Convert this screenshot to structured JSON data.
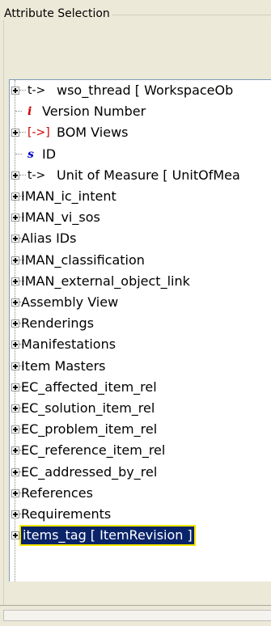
{
  "group_title": "Attribute Selection",
  "tree": [
    {
      "label": "wso_thread [ WorkspaceOb",
      "icon_text": "t->",
      "icon_color": "#000000",
      "expander": true
    },
    {
      "label": "Version Number",
      "icon_text": "i",
      "icon_color": "#cc0000",
      "expander": false
    },
    {
      "label": "BOM Views",
      "icon_text": "[->]",
      "icon_color": "#cc0000",
      "expander": true
    },
    {
      "label": "ID",
      "icon_text": "s",
      "icon_color": "#0000cc",
      "expander": false
    },
    {
      "label": "Unit of Measure [ UnitOfMea",
      "icon_text": "t->",
      "icon_color": "#000000",
      "expander": true
    },
    {
      "label": "IMAN_ic_intent",
      "icon_text": "",
      "icon_color": "#000000",
      "expander": true
    },
    {
      "label": "IMAN_vi_sos",
      "icon_text": "",
      "icon_color": "#000000",
      "expander": true
    },
    {
      "label": "Alias IDs",
      "icon_text": "",
      "icon_color": "#000000",
      "expander": true
    },
    {
      "label": "IMAN_classification",
      "icon_text": "",
      "icon_color": "#000000",
      "expander": true
    },
    {
      "label": "IMAN_external_object_link",
      "icon_text": "",
      "icon_color": "#000000",
      "expander": true
    },
    {
      "label": "Assembly View",
      "icon_text": "",
      "icon_color": "#000000",
      "expander": true
    },
    {
      "label": "Renderings",
      "icon_text": "",
      "icon_color": "#000000",
      "expander": true
    },
    {
      "label": "Manifestations",
      "icon_text": "",
      "icon_color": "#000000",
      "expander": true
    },
    {
      "label": "Item Masters",
      "icon_text": "",
      "icon_color": "#000000",
      "expander": true
    },
    {
      "label": "EC_affected_item_rel",
      "icon_text": "",
      "icon_color": "#000000",
      "expander": true
    },
    {
      "label": "EC_solution_item_rel",
      "icon_text": "",
      "icon_color": "#000000",
      "expander": true
    },
    {
      "label": "EC_problem_item_rel",
      "icon_text": "",
      "icon_color": "#000000",
      "expander": true
    },
    {
      "label": "EC_reference_item_rel",
      "icon_text": "",
      "icon_color": "#000000",
      "expander": true
    },
    {
      "label": "EC_addressed_by_rel",
      "icon_text": "",
      "icon_color": "#000000",
      "expander": true
    },
    {
      "label": "References",
      "icon_text": "",
      "icon_color": "#000000",
      "expander": true
    },
    {
      "label": "Requirements",
      "icon_text": "",
      "icon_color": "#000000",
      "expander": true
    },
    {
      "label": "items_tag [ ItemRevision ]",
      "icon_text": "",
      "icon_color": "#000000",
      "expander": true,
      "selected": true
    }
  ]
}
